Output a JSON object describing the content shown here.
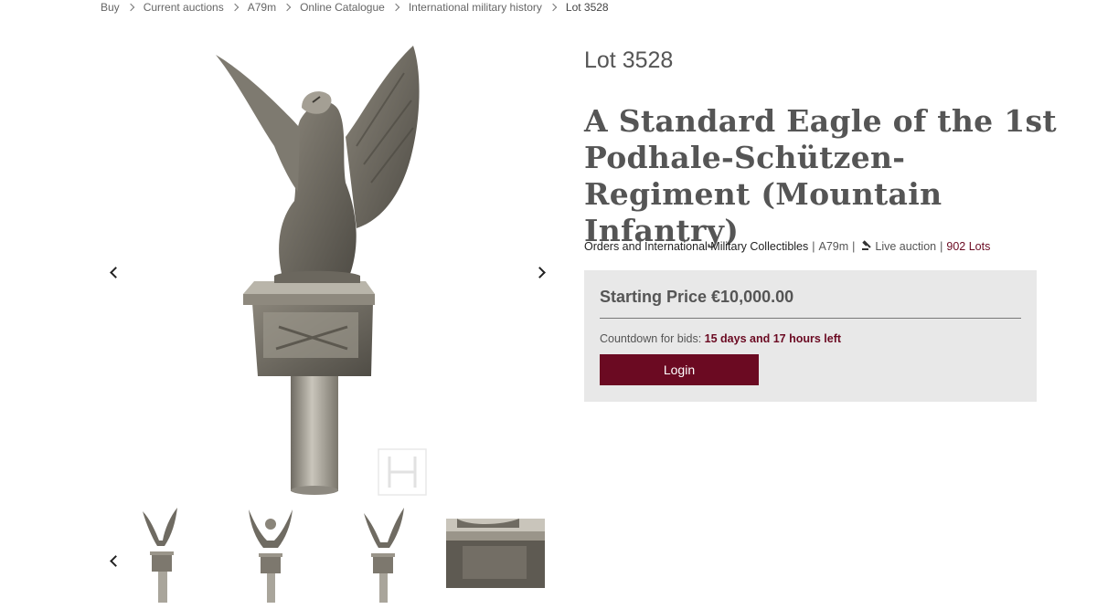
{
  "breadcrumb": {
    "items": [
      "Buy",
      "Current auctions",
      "A79m",
      "Online Catalogue",
      "International military history",
      "Lot 3528"
    ]
  },
  "lot": {
    "number": "Lot 3528",
    "title": "A Standard Eagle of the 1st Podhale-Schützen-Regiment (Mountain Infantry)"
  },
  "meta": {
    "department": "Orders and International Military Collectibles",
    "sep": "|",
    "auction": "A79m",
    "type": "Live auction",
    "lots": "902 Lots"
  },
  "bidding": {
    "price": "Starting Price €10,000.00",
    "countdown_label": "Countdown for bids:",
    "countdown_value": "15 days and 17 hours left",
    "login_label": "Login"
  },
  "icons": {
    "gallery_prev": "chevron-left-icon",
    "gallery_next": "chevron-right-icon",
    "thumb_prev": "chevron-left-icon",
    "auction_type": "gavel-icon",
    "watermark": "H"
  },
  "colors": {
    "accent": "#6b0a22",
    "panel": "#e8e8e8",
    "silver": "#a9a59b"
  }
}
